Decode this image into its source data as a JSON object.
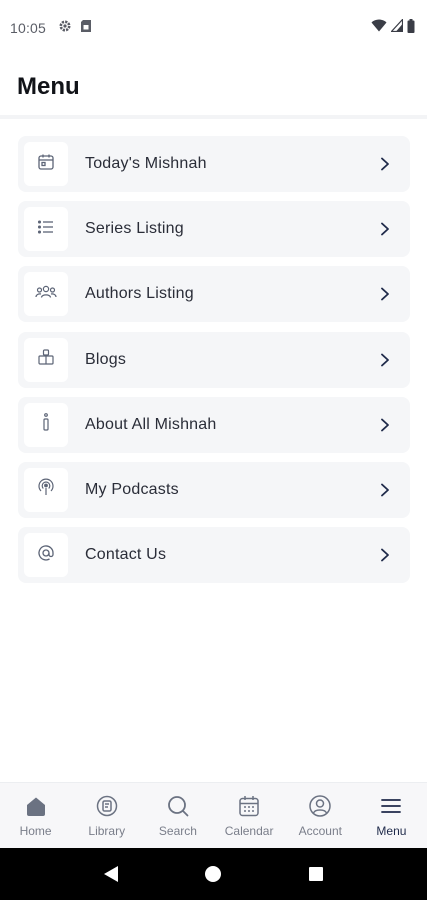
{
  "status_bar": {
    "time": "10:05",
    "icons": [
      "gear-icon",
      "sim-card-icon",
      "wifi-icon",
      "signal-icon",
      "battery-icon"
    ]
  },
  "page": {
    "title": "Menu"
  },
  "menu": {
    "items": [
      {
        "label": "Today's Mishnah",
        "icon": "calendar-icon"
      },
      {
        "label": "Series Listing",
        "icon": "list-icon"
      },
      {
        "label": "Authors Listing",
        "icon": "users-icon"
      },
      {
        "label": "Blogs",
        "icon": "blog-icon"
      },
      {
        "label": "About All Mishnah",
        "icon": "info-icon"
      },
      {
        "label": "My Podcasts",
        "icon": "podcast-icon"
      },
      {
        "label": "Contact Us",
        "icon": "at-icon"
      }
    ]
  },
  "bottom_nav": {
    "active": "Menu",
    "items": [
      {
        "label": "Home",
        "icon": "home-icon"
      },
      {
        "label": "Library",
        "icon": "library-icon"
      },
      {
        "label": "Search",
        "icon": "search-icon"
      },
      {
        "label": "Calendar",
        "icon": "calendar-icon"
      },
      {
        "label": "Account",
        "icon": "account-icon"
      },
      {
        "label": "Menu",
        "icon": "menu-icon"
      }
    ]
  },
  "colors": {
    "accent": "#1f2a4a",
    "card_background": "#f5f6f8",
    "nav_inactive": "#7a7e8a"
  }
}
